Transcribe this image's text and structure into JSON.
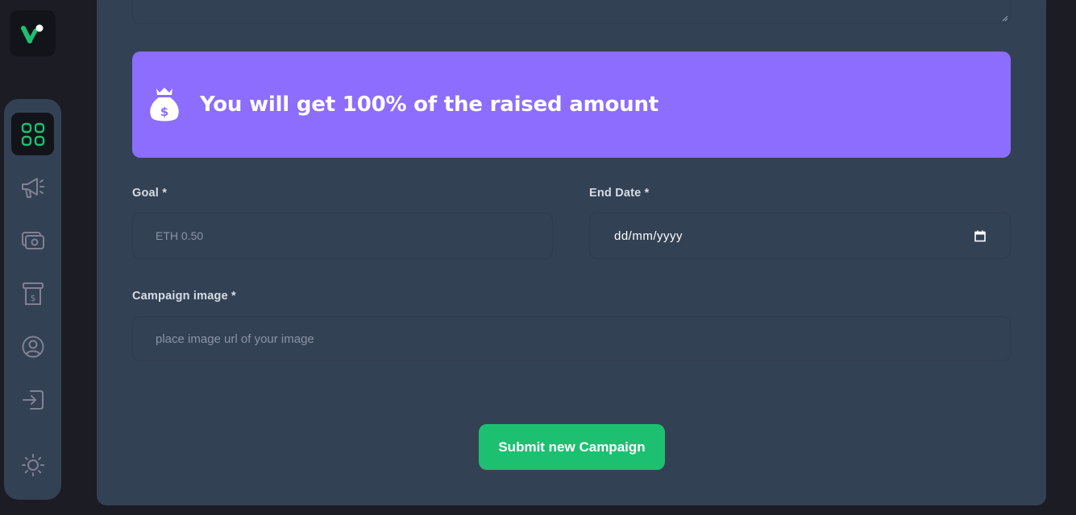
{
  "app": {
    "logo_icon": "app-logo-icon"
  },
  "sidebar": {
    "items": [
      {
        "name": "dashboard",
        "icon": "dashboard-grid-icon",
        "active": true
      },
      {
        "name": "campaign",
        "icon": "megaphone-icon",
        "active": false
      },
      {
        "name": "payment",
        "icon": "money-icon",
        "active": false
      },
      {
        "name": "withdraw",
        "icon": "cash-register-icon",
        "active": false
      },
      {
        "name": "profile",
        "icon": "user-icon",
        "active": false
      },
      {
        "name": "logout",
        "icon": "logout-icon",
        "active": false
      },
      {
        "name": "theme",
        "icon": "sun-icon",
        "active": false
      }
    ]
  },
  "banner": {
    "icon": "money-bag-icon",
    "text": "You will get 100% of the raised amount"
  },
  "form": {
    "goal": {
      "label": "Goal *",
      "placeholder": "ETH 0.50",
      "value": ""
    },
    "end_date": {
      "label": "End Date *",
      "placeholder": "dd/mm/yyyy"
    },
    "image": {
      "label": "Campaign image *",
      "placeholder": "place image url of your image",
      "value": ""
    },
    "submit_label": "Submit new Campaign"
  },
  "colors": {
    "background": "#1c1c24",
    "panel": "#334155",
    "accent_purple": "#8c6dfd",
    "accent_green": "#1dc071",
    "active_icon": "#1dc071",
    "inactive_icon": "#808191"
  }
}
